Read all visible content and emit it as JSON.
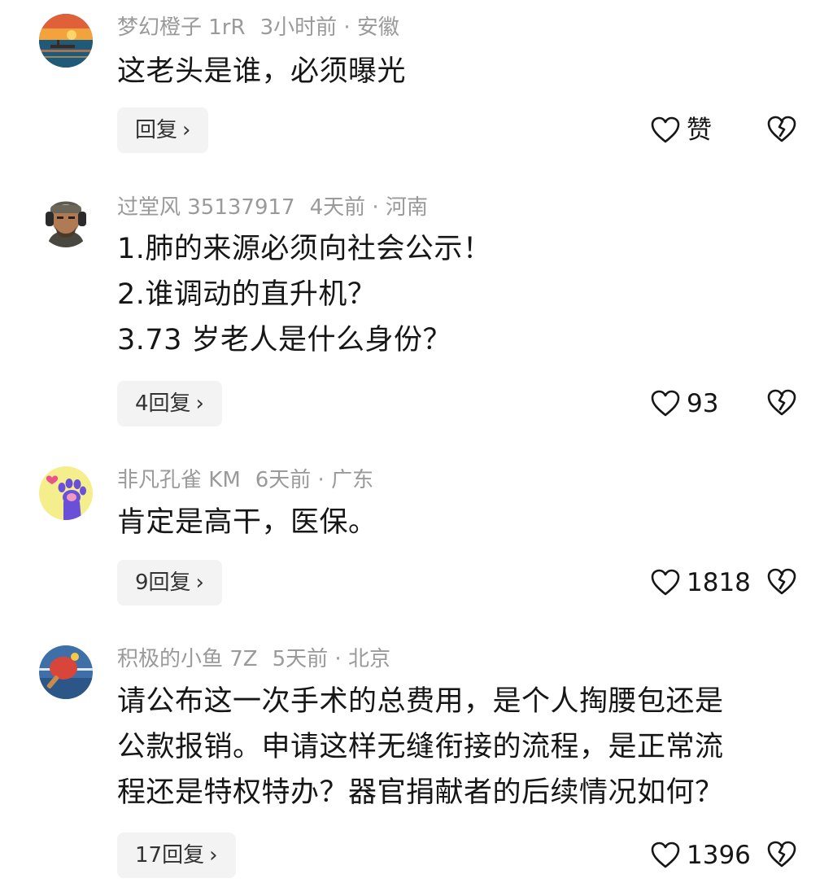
{
  "comments": [
    {
      "username": "梦幻橙子 1rR",
      "time_location": "3小时前 · 安徽",
      "lines": [
        "这老头是谁，必须曝光"
      ],
      "reply_label": "回复",
      "like_label": "赞",
      "avatar": "sunset-lake-avatar"
    },
    {
      "username": "过堂风 35137917",
      "time_location": "4天前 · 河南",
      "lines": [
        "1.肺的来源必须向社会公示！",
        "2.谁调动的直升机？",
        "3.73 岁老人是什么身份？"
      ],
      "reply_label": "4回复",
      "like_label": "93",
      "avatar": "soldier-headset-avatar"
    },
    {
      "username": "非凡孔雀 KM",
      "time_location": "6天前 · 广东",
      "lines": [
        "肯定是高干，医保。"
      ],
      "reply_label": "9回复",
      "like_label": "1818",
      "avatar": "paw-heart-avatar"
    },
    {
      "username": "积极的小鱼 7Z",
      "time_location": "5天前 · 北京",
      "lines": [
        "请公布这一次手术的总费用，是个人掏腰包还是",
        "公款报销。申请这样无缝衔接的流程，是正常流",
        "程还是特权特办？器官捐献者的后续情况如何？"
      ],
      "reply_label": "17回复",
      "like_label": "1396",
      "avatar": "ping-pong-avatar"
    }
  ],
  "icons": {
    "reply_chevron": "chevron-right-icon",
    "like": "heart-outline-icon",
    "dislike": "broken-heart-icon"
  },
  "colors": {
    "meta_text": "#9a9a9a",
    "body_text": "#161616",
    "reply_bg": "#f3f3f3"
  }
}
